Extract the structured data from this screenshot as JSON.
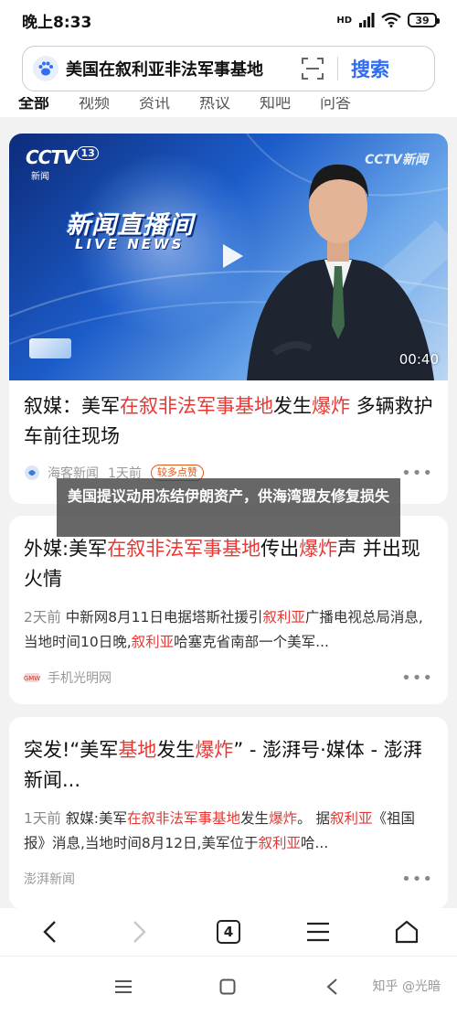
{
  "status": {
    "time": "晚上8:33",
    "network": "HD",
    "battery": "39"
  },
  "search": {
    "query": "美国在叙利亚非法军事基地",
    "button": "搜索"
  },
  "tabs": [
    "全部",
    "视频",
    "资讯",
    "热议",
    "知吧",
    "问答"
  ],
  "results": [
    {
      "title_parts": [
        {
          "t": "叙媒：美军",
          "hl": false
        },
        {
          "t": "在叙非法军事基地",
          "hl": true
        },
        {
          "t": "发生",
          "hl": false
        },
        {
          "t": "爆炸",
          "hl": true
        },
        {
          "t": " 多辆救护车前往现场",
          "hl": false
        }
      ],
      "video": {
        "channel_logo": "CCTV",
        "channel_number": "13",
        "channel_sub": "新闻",
        "corner_logo": "CCTV新闻",
        "program_title": "新闻直播间",
        "program_sub": "LIVE NEWS",
        "duration": "00:40"
      },
      "source": "海客新闻",
      "time": "1天前",
      "badge": "较多点赞"
    },
    {
      "title_parts": [
        {
          "t": "外媒:美军",
          "hl": false
        },
        {
          "t": "在叙非法军事基地",
          "hl": true
        },
        {
          "t": "传出",
          "hl": false
        },
        {
          "t": "爆炸",
          "hl": true
        },
        {
          "t": "声 并出现火情",
          "hl": false
        }
      ],
      "snippet_parts": [
        {
          "t": "2天前",
          "hl": false,
          "muted": true
        },
        {
          "t": "  中新网8月11日电据塔斯社援引",
          "hl": false
        },
        {
          "t": "叙利亚",
          "hl": true
        },
        {
          "t": "广播电视总局消息,当地时间10日晚,",
          "hl": false
        },
        {
          "t": "叙利亚",
          "hl": true
        },
        {
          "t": "哈塞克省南部一个美军...",
          "hl": false
        }
      ],
      "source": "手机光明网"
    },
    {
      "title_parts": [
        {
          "t": "突发!“美军",
          "hl": false
        },
        {
          "t": "基地",
          "hl": true
        },
        {
          "t": "发生",
          "hl": false
        },
        {
          "t": "爆炸",
          "hl": true
        },
        {
          "t": "” - 澎湃号·媒体 - 澎湃新闻...",
          "hl": false
        }
      ],
      "snippet_parts": [
        {
          "t": "1天前",
          "hl": false,
          "muted": true
        },
        {
          "t": "  叙媒:美军",
          "hl": false
        },
        {
          "t": "在叙非法军事基地",
          "hl": true
        },
        {
          "t": "发生",
          "hl": false
        },
        {
          "t": "爆炸",
          "hl": true
        },
        {
          "t": "。 据",
          "hl": false
        },
        {
          "t": "叙利亚",
          "hl": true
        },
        {
          "t": "《祖国报》消息,当地时间8月12日,美军位于",
          "hl": false
        },
        {
          "t": "叙利亚",
          "hl": true
        },
        {
          "t": "哈...",
          "hl": false
        }
      ],
      "source": "澎湃新闻"
    }
  ],
  "overlay_caption": "美国提议动用冻结伊朗资产，供海湾盟友修复损失",
  "browser_nav": {
    "tab_count": "4"
  },
  "watermark": "知乎 @光暗",
  "colors": {
    "accent": "#2f6df5",
    "highlight": "#e53935",
    "badge": "#e05a1a"
  }
}
